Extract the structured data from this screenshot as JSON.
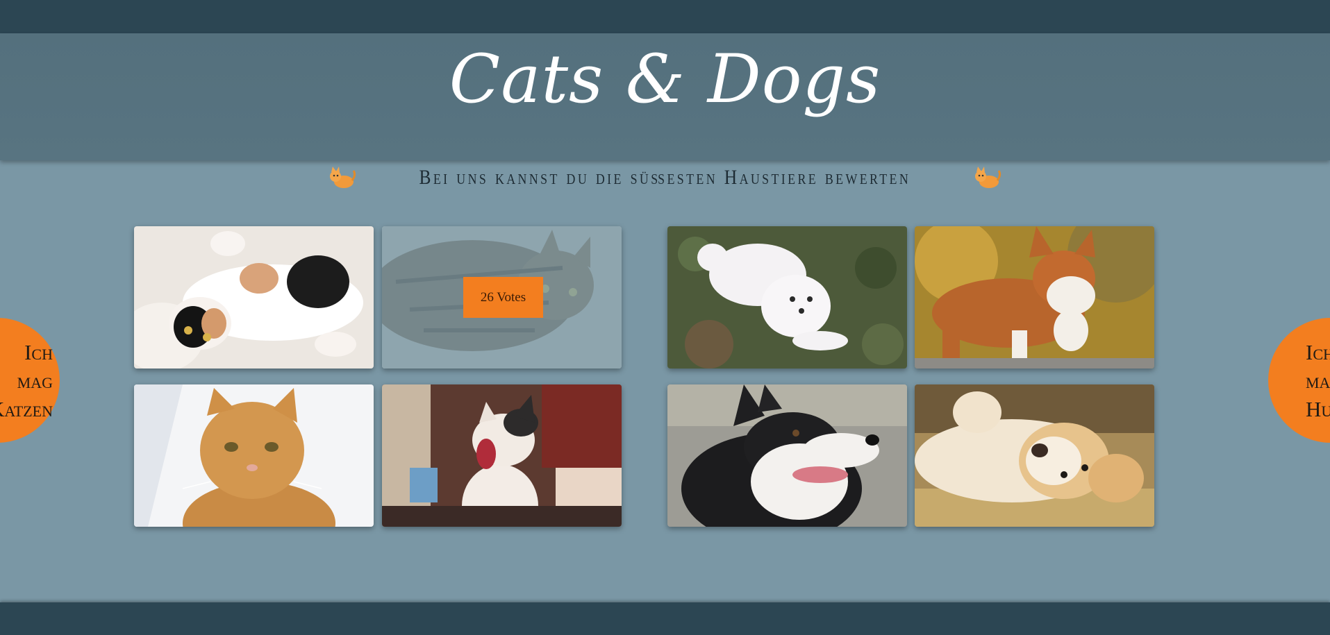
{
  "header": {
    "title": "Cats & Dogs"
  },
  "tagline": {
    "text": "Bei uns kannst du die süßesten Haustiere bewerten",
    "icon": "cat-emoji-icon"
  },
  "cats": {
    "photos": [
      {
        "name": "calico-cat-photo",
        "dimmed": false
      },
      {
        "name": "tabby-cat-photo",
        "dimmed": true,
        "votes_label": "26 Votes"
      },
      {
        "name": "orange-cat-photo",
        "dimmed": false
      },
      {
        "name": "yawning-kitten-photo",
        "dimmed": false
      }
    ],
    "vote_button": {
      "lines": [
        "Ich",
        "mag",
        "Katzen"
      ]
    }
  },
  "dogs": {
    "photos": [
      {
        "name": "white-dog-photo",
        "dimmed": false
      },
      {
        "name": "corgi-photo",
        "dimmed": false
      },
      {
        "name": "husky-photo",
        "dimmed": false
      },
      {
        "name": "golden-dog-photo",
        "dimmed": false
      }
    ],
    "vote_button": {
      "lines": [
        "Ich",
        "mag",
        "Hunde"
      ]
    }
  },
  "colors": {
    "accent": "#f37e1f",
    "background": "#7a97a5",
    "header": "#587481",
    "bars": "#2c4653"
  }
}
